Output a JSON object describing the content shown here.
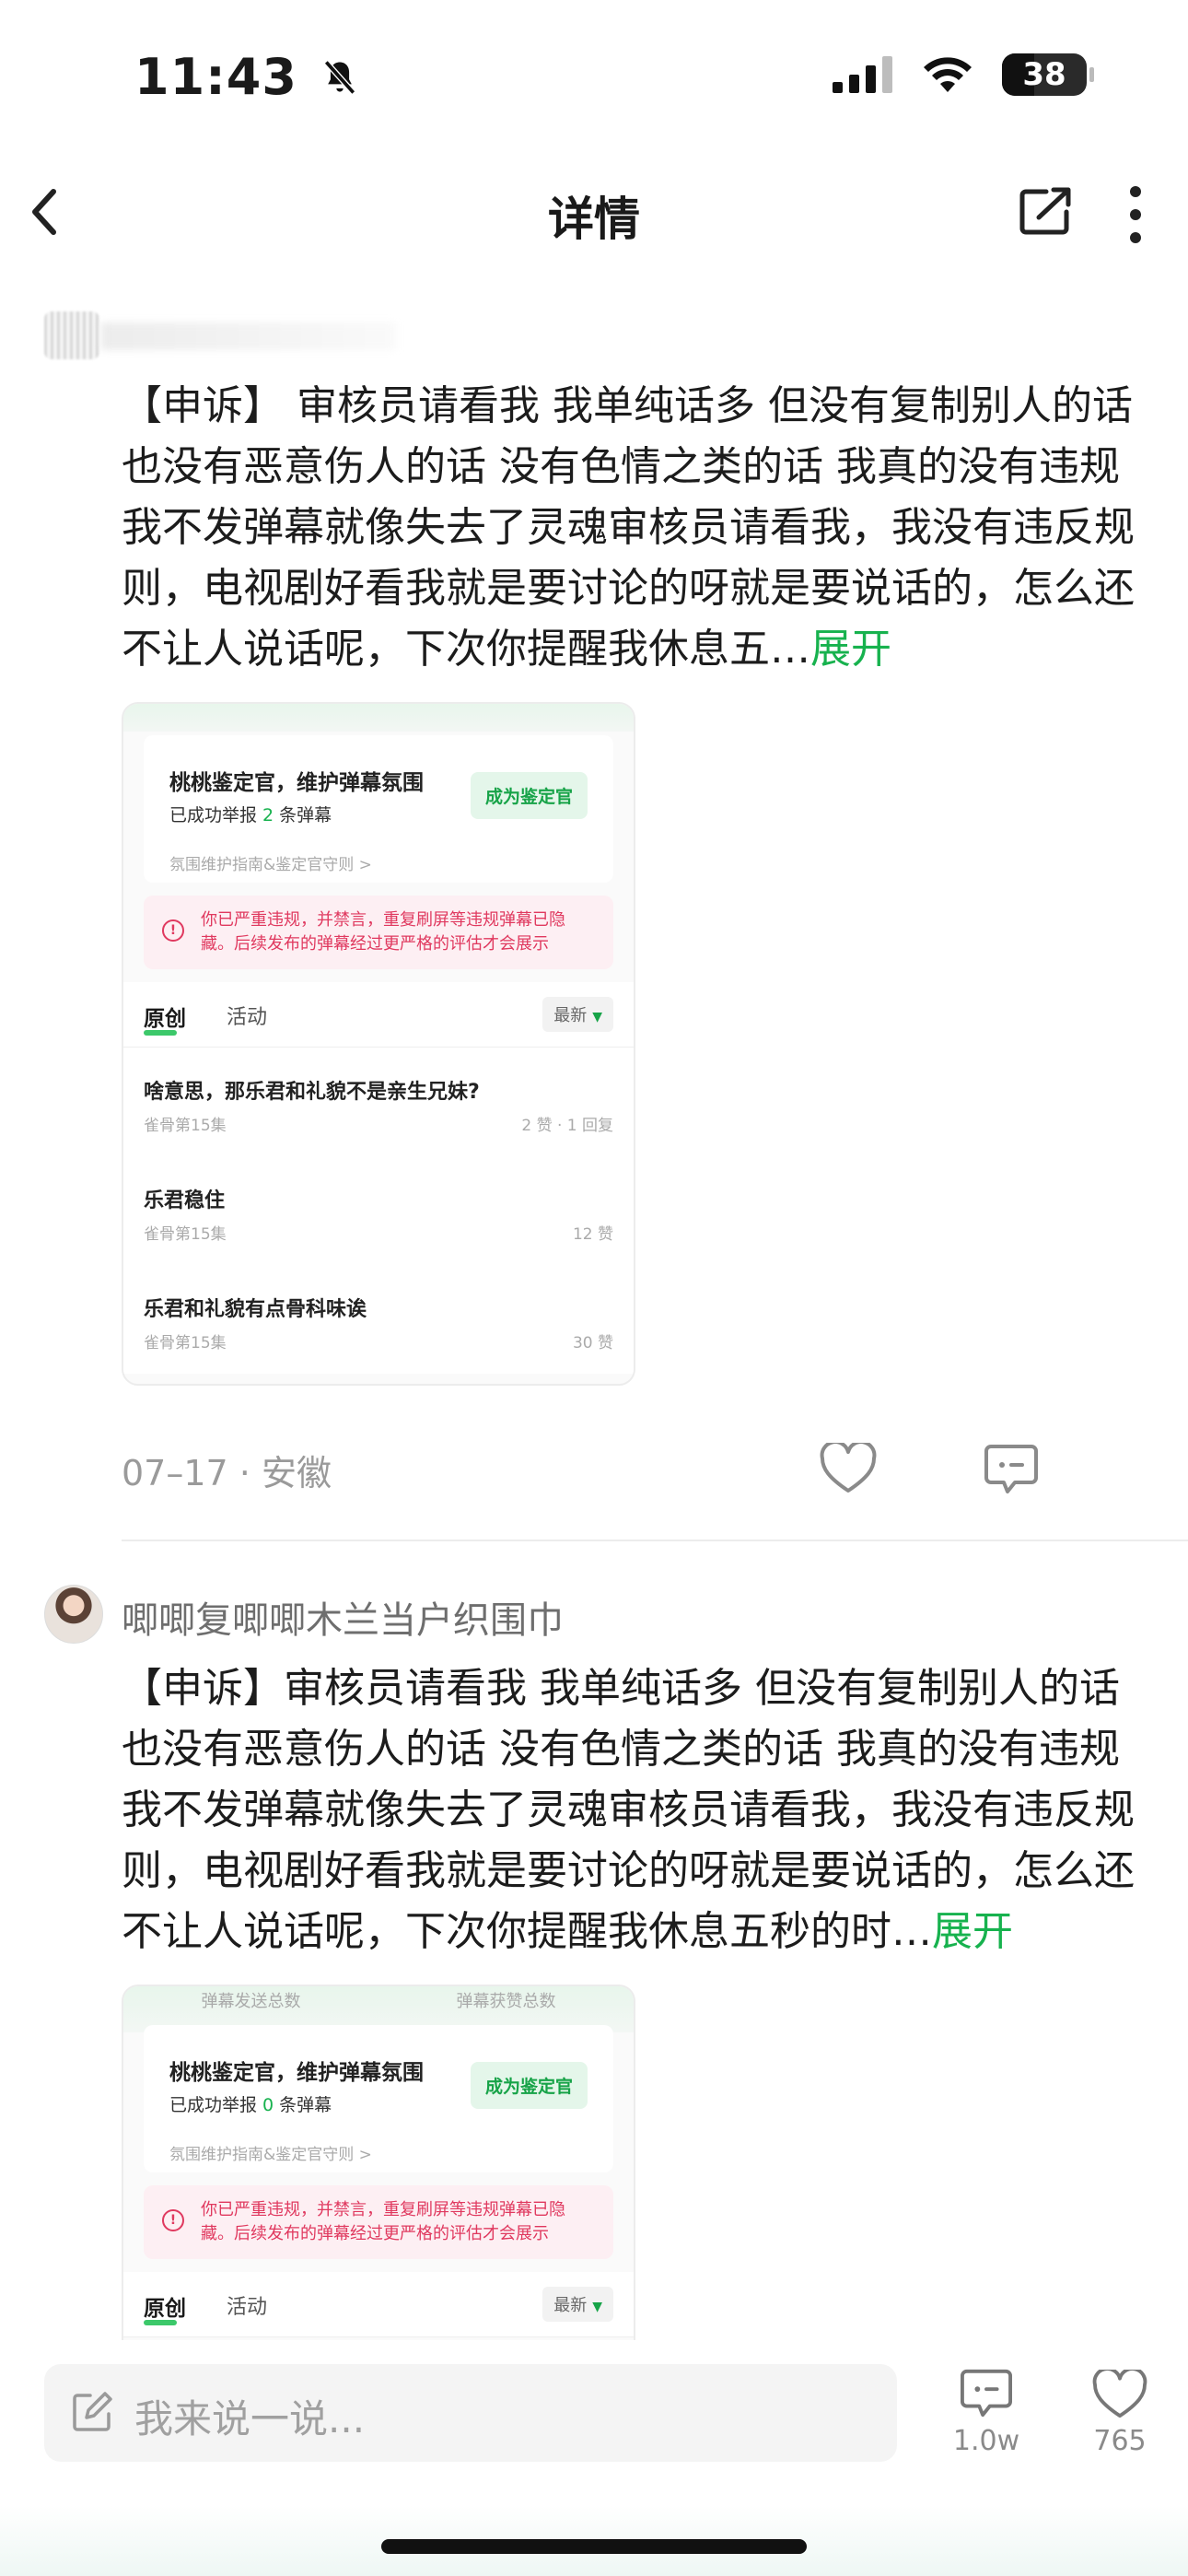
{
  "status_bar": {
    "time": "11:43",
    "battery": "38"
  },
  "nav": {
    "title": "详情"
  },
  "post1": {
    "text": "【申诉】 审核员请看我 我单纯话多 但没有复制别人的话 也没有恶意伤人的话 没有色情之类的话 我真的没有违规我不发弹幕就像失去了灵魂审核员请看我，我没有违反规则，电视剧好看我就是要讨论的呀就是要说话的，怎么还不让人说话呢，下次你提醒我休息五…",
    "expand": "展开",
    "screenshot": {
      "card_title": "桃桃鉴定官，维护弹幕氛围",
      "card_sub_prefix": "已成功举报 ",
      "card_sub_count": "2",
      "card_sub_suffix": " 条弹幕",
      "card_button": "成为鉴定官",
      "card_guide": "氛围维护指南&鉴定官守则 >",
      "warning": "你已严重违规，并禁言，重复刷屏等违规弹幕已隐藏。后续发布的弹幕经过更严格的评估才会展示",
      "tab_original": "原创",
      "tab_activity": "活动",
      "sort": "最新",
      "rows": [
        {
          "title": "啥意思，那乐君和礼貌不是亲生兄妹?",
          "sub": "雀骨第15集",
          "meta": "2 赞 · 1 回复"
        },
        {
          "title": "乐君稳住",
          "sub": "雀骨第15集",
          "meta": "12 赞"
        },
        {
          "title": "乐君和礼貌有点骨科味诶",
          "sub": "雀骨第15集",
          "meta": "30 赞"
        }
      ]
    },
    "meta": "07–17 · 安徽"
  },
  "post2": {
    "username": "唧唧复唧唧木兰当户织围巾",
    "text": "【申诉】审核员请看我 我单纯话多 但没有复制别人的话 也没有恶意伤人的话 没有色情之类的话 我真的没有违规我不发弹幕就像失去了灵魂审核员请看我，我没有违反规则，电视剧好看我就是要讨论的呀就是要说话的，怎么还不让人说话呢，下次你提醒我休息五秒的时…",
    "expand": "展开",
    "screenshot": {
      "header_left": "弹幕发送总数",
      "header_right": "弹幕获赞总数",
      "card_title": "桃桃鉴定官，维护弹幕氛围",
      "card_sub_prefix": "已成功举报 ",
      "card_sub_count": "0",
      "card_sub_suffix": " 条弹幕",
      "card_button": "成为鉴定官",
      "card_guide": "氛围维护指南&鉴定官守则 >",
      "warning": "你已严重违规，并禁言，重复刷屏等违规弹幕已隐藏。后续发布的弹幕经过更严格的评估才会展示",
      "tab_original": "原创",
      "tab_activity": "活动",
      "sort": "最新"
    }
  },
  "bottom_bar": {
    "placeholder": "我来说一说...",
    "comment_count": "1.0w",
    "like_count": "765"
  }
}
